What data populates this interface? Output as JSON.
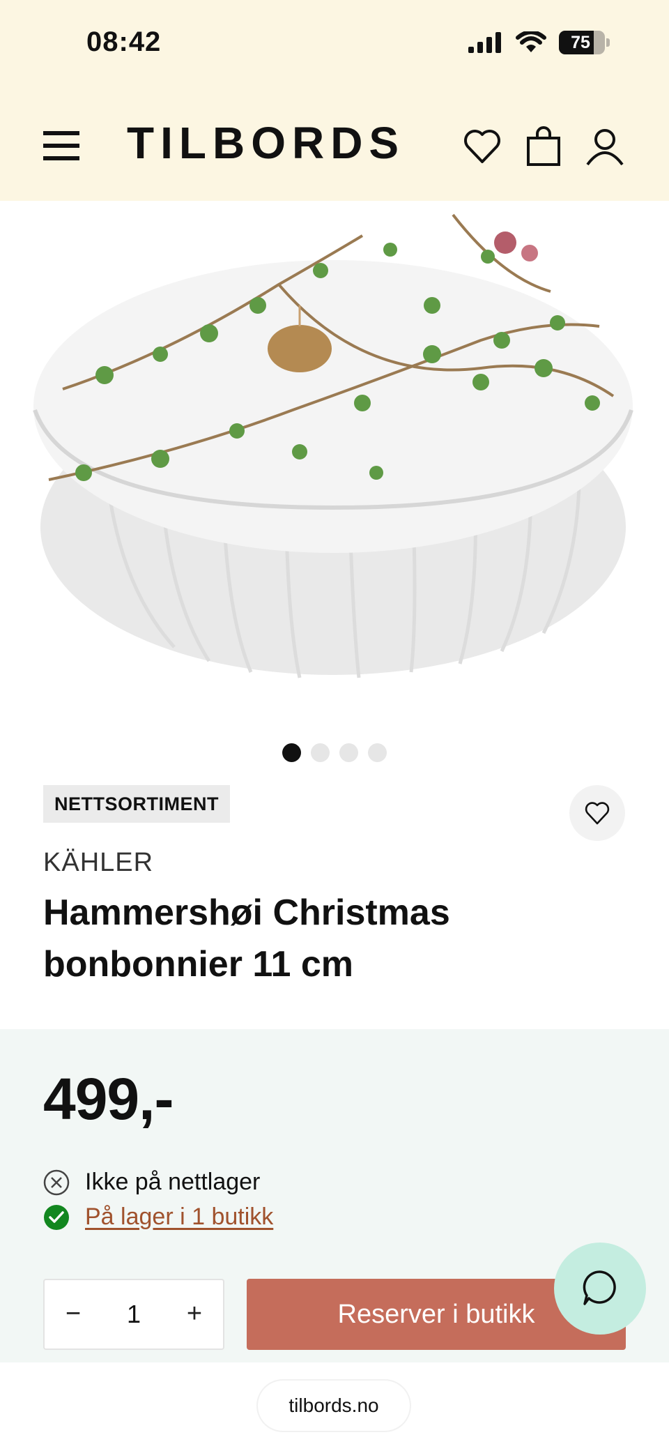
{
  "status_bar": {
    "time": "08:42",
    "battery": "75",
    "battery_level": 0.75
  },
  "header": {
    "logo": "TILBORDS",
    "background": "#fcf6e2"
  },
  "gallery": {
    "slide_count": 4,
    "active_index": 0
  },
  "product": {
    "badge": "NETTSORTIMENT",
    "brand": "KÄHLER",
    "title": "Hammershøi Christmas bonbonnier 11 cm",
    "price": "499,-"
  },
  "stock": {
    "online": "Ikke på nettlager",
    "store_link": "På lager i 1 butikk"
  },
  "purchase": {
    "quantity": "1",
    "minus_label": "−",
    "plus_label": "+",
    "reserve_label": "Reserver i butikk"
  },
  "colors": {
    "accent": "#c56d5b",
    "price_panel": "#f2f7f5",
    "chat": "#c4ede0",
    "in_stock": "#12871f",
    "link": "#a0522d"
  },
  "browser": {
    "url": "tilbords.no"
  }
}
